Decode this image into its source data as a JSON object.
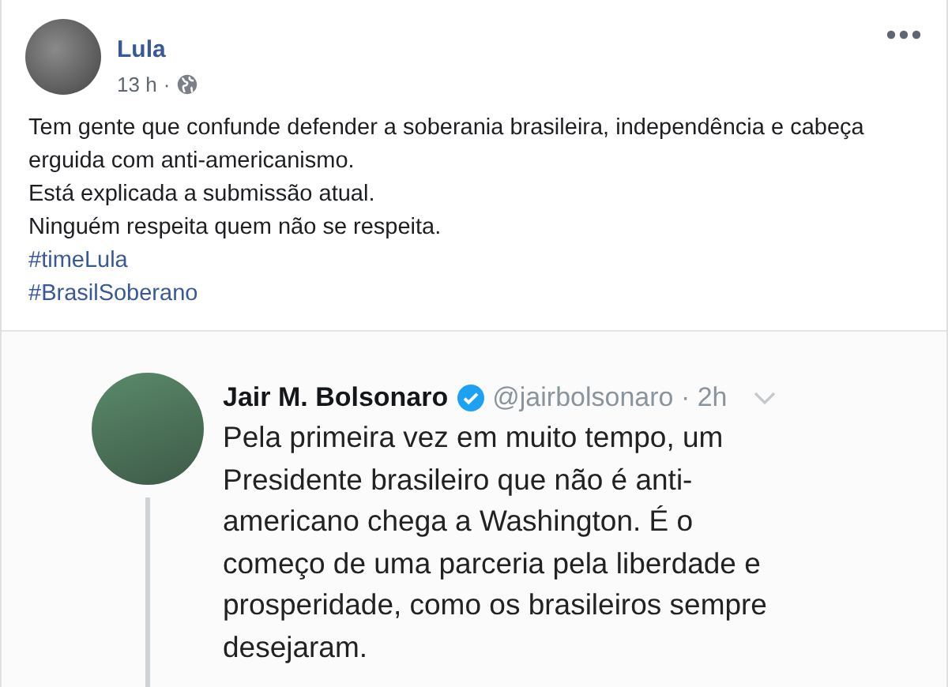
{
  "post": {
    "author": "Lula",
    "time": "13 h",
    "separator": "·",
    "text_lines": [
      "Tem gente que confunde defender a soberania brasileira, independência e cabeça erguida com anti-americanismo.",
      "Está explicada a submissão atual.",
      "Ninguém respeita quem não se respeita."
    ],
    "hashtags": [
      "#timeLula",
      "#BrasilSoberano"
    ]
  },
  "tweet": {
    "name": "Jair M. Bolsonaro",
    "handle": "@jairbolsonaro · 2h",
    "lines": [
      "Pela primeira vez em muito tempo, um",
      "Presidente brasileiro que não é anti-",
      "americano chega a Washington. É o",
      "começo de uma parceria pela liberdade e",
      "prosperidade, como os brasileiros sempre",
      "desejaram."
    ]
  }
}
